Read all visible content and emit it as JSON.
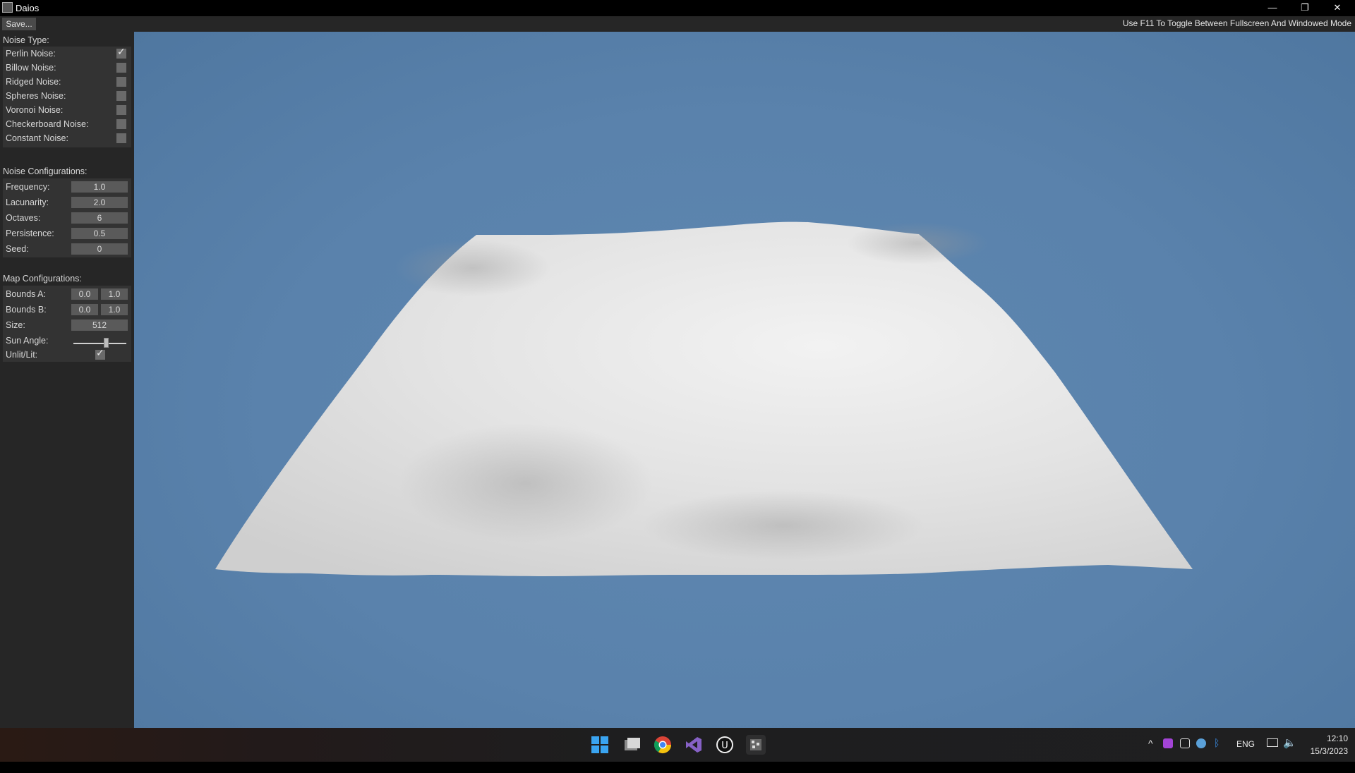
{
  "window": {
    "title": "Daios",
    "minimize_glyph": "—",
    "restore_glyph": "❐",
    "close_glyph": "✕"
  },
  "menu": {
    "save_label": "Save...",
    "hint": "Use F11 To Toggle Between Fullscreen And Windowed Mode"
  },
  "noise_type": {
    "title": "Noise Type:",
    "items": [
      {
        "label": "Perlin Noise:",
        "checked": true
      },
      {
        "label": "Billow Noise:",
        "checked": false
      },
      {
        "label": "Ridged Noise:",
        "checked": false
      },
      {
        "label": "Spheres Noise:",
        "checked": false
      },
      {
        "label": "Voronoi Noise:",
        "checked": false
      },
      {
        "label": "Checkerboard Noise:",
        "checked": false
      },
      {
        "label": "Constant Noise:",
        "checked": false
      }
    ]
  },
  "noise_config": {
    "title": "Noise Configurations:",
    "fields": [
      {
        "label": "Frequency:",
        "value": "1.0"
      },
      {
        "label": "Lacunarity:",
        "value": "2.0"
      },
      {
        "label": "Octaves:",
        "value": "6"
      },
      {
        "label": "Persistence:",
        "value": "0.5"
      },
      {
        "label": "Seed:",
        "value": "0"
      }
    ]
  },
  "map_config": {
    "title": "Map Configurations:",
    "bounds_a": {
      "label": "Bounds A:",
      "min": "0.0",
      "max": "1.0"
    },
    "bounds_b": {
      "label": "Bounds B:",
      "min": "0.0",
      "max": "1.0"
    },
    "size": {
      "label": "Size:",
      "value": "512"
    },
    "sun_angle": {
      "label": "Sun Angle:",
      "level": 0.6
    },
    "unlit_lit": {
      "label": "Unlit/Lit:",
      "checked": true
    }
  },
  "taskbar": {
    "apps": [
      "windows-start-icon",
      "file-explorer-icon",
      "chrome-icon",
      "visual-studio-icon",
      "unreal-engine-icon",
      "daios-app-icon"
    ],
    "tray_language": "ENG",
    "time": "12:10",
    "date": "15/3/2023"
  },
  "colors": {
    "sky": "#5a82ac",
    "panel": "#333333",
    "sidebar": "#262626",
    "terrain": "#e6e6e6"
  }
}
